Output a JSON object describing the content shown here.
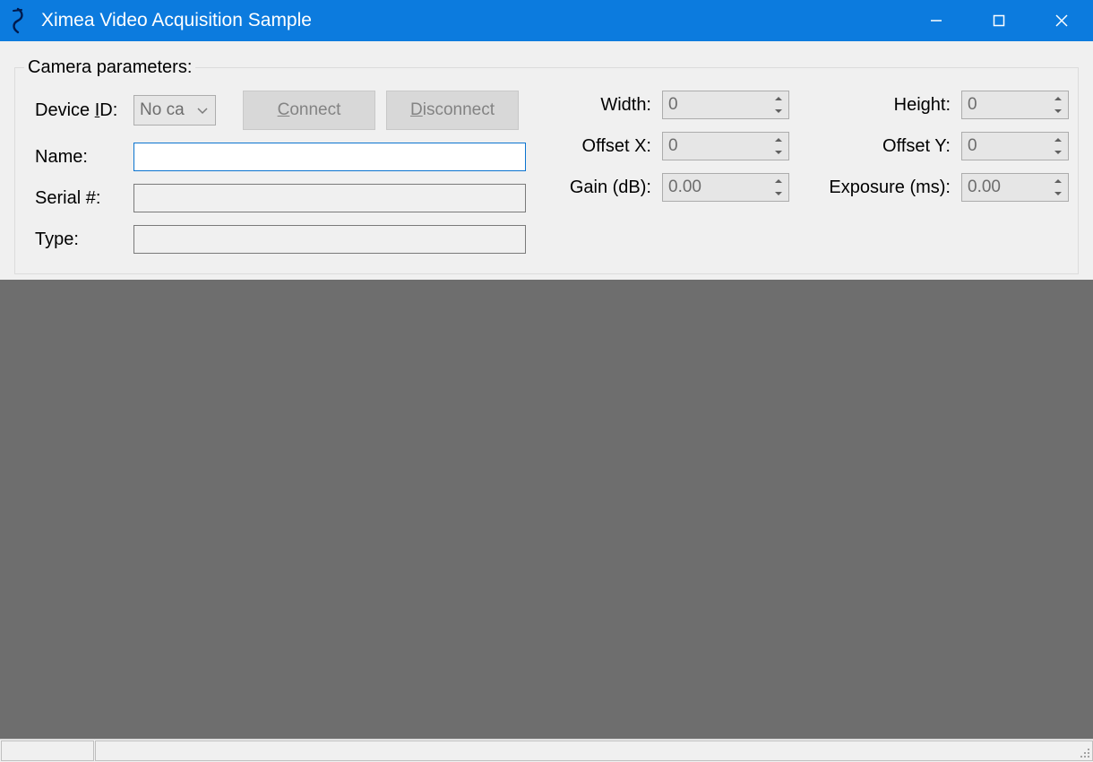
{
  "window": {
    "title": "Ximea Video Acquisition Sample"
  },
  "group": {
    "legend": "Camera parameters:"
  },
  "labels": {
    "device_id_pre": "Device ",
    "device_id_hot": "I",
    "device_id_post": "D:",
    "name": "Name:",
    "serial": "Serial #:",
    "type": "Type:",
    "width": "Width:",
    "height": "Height:",
    "offset_x": "Offset X:",
    "offset_y": "Offset Y:",
    "gain": "Gain (dB):",
    "exposure": "Exposure (ms):"
  },
  "buttons": {
    "connect_hot": "C",
    "connect_rest": "onnect",
    "disconnect_hot": "D",
    "disconnect_rest": "isconnect"
  },
  "values": {
    "device_combo": "No ca",
    "name": "",
    "serial": "",
    "type": "",
    "width": "0",
    "height": "0",
    "offset_x": "0",
    "offset_y": "0",
    "gain": "0.00",
    "exposure": "0.00"
  }
}
